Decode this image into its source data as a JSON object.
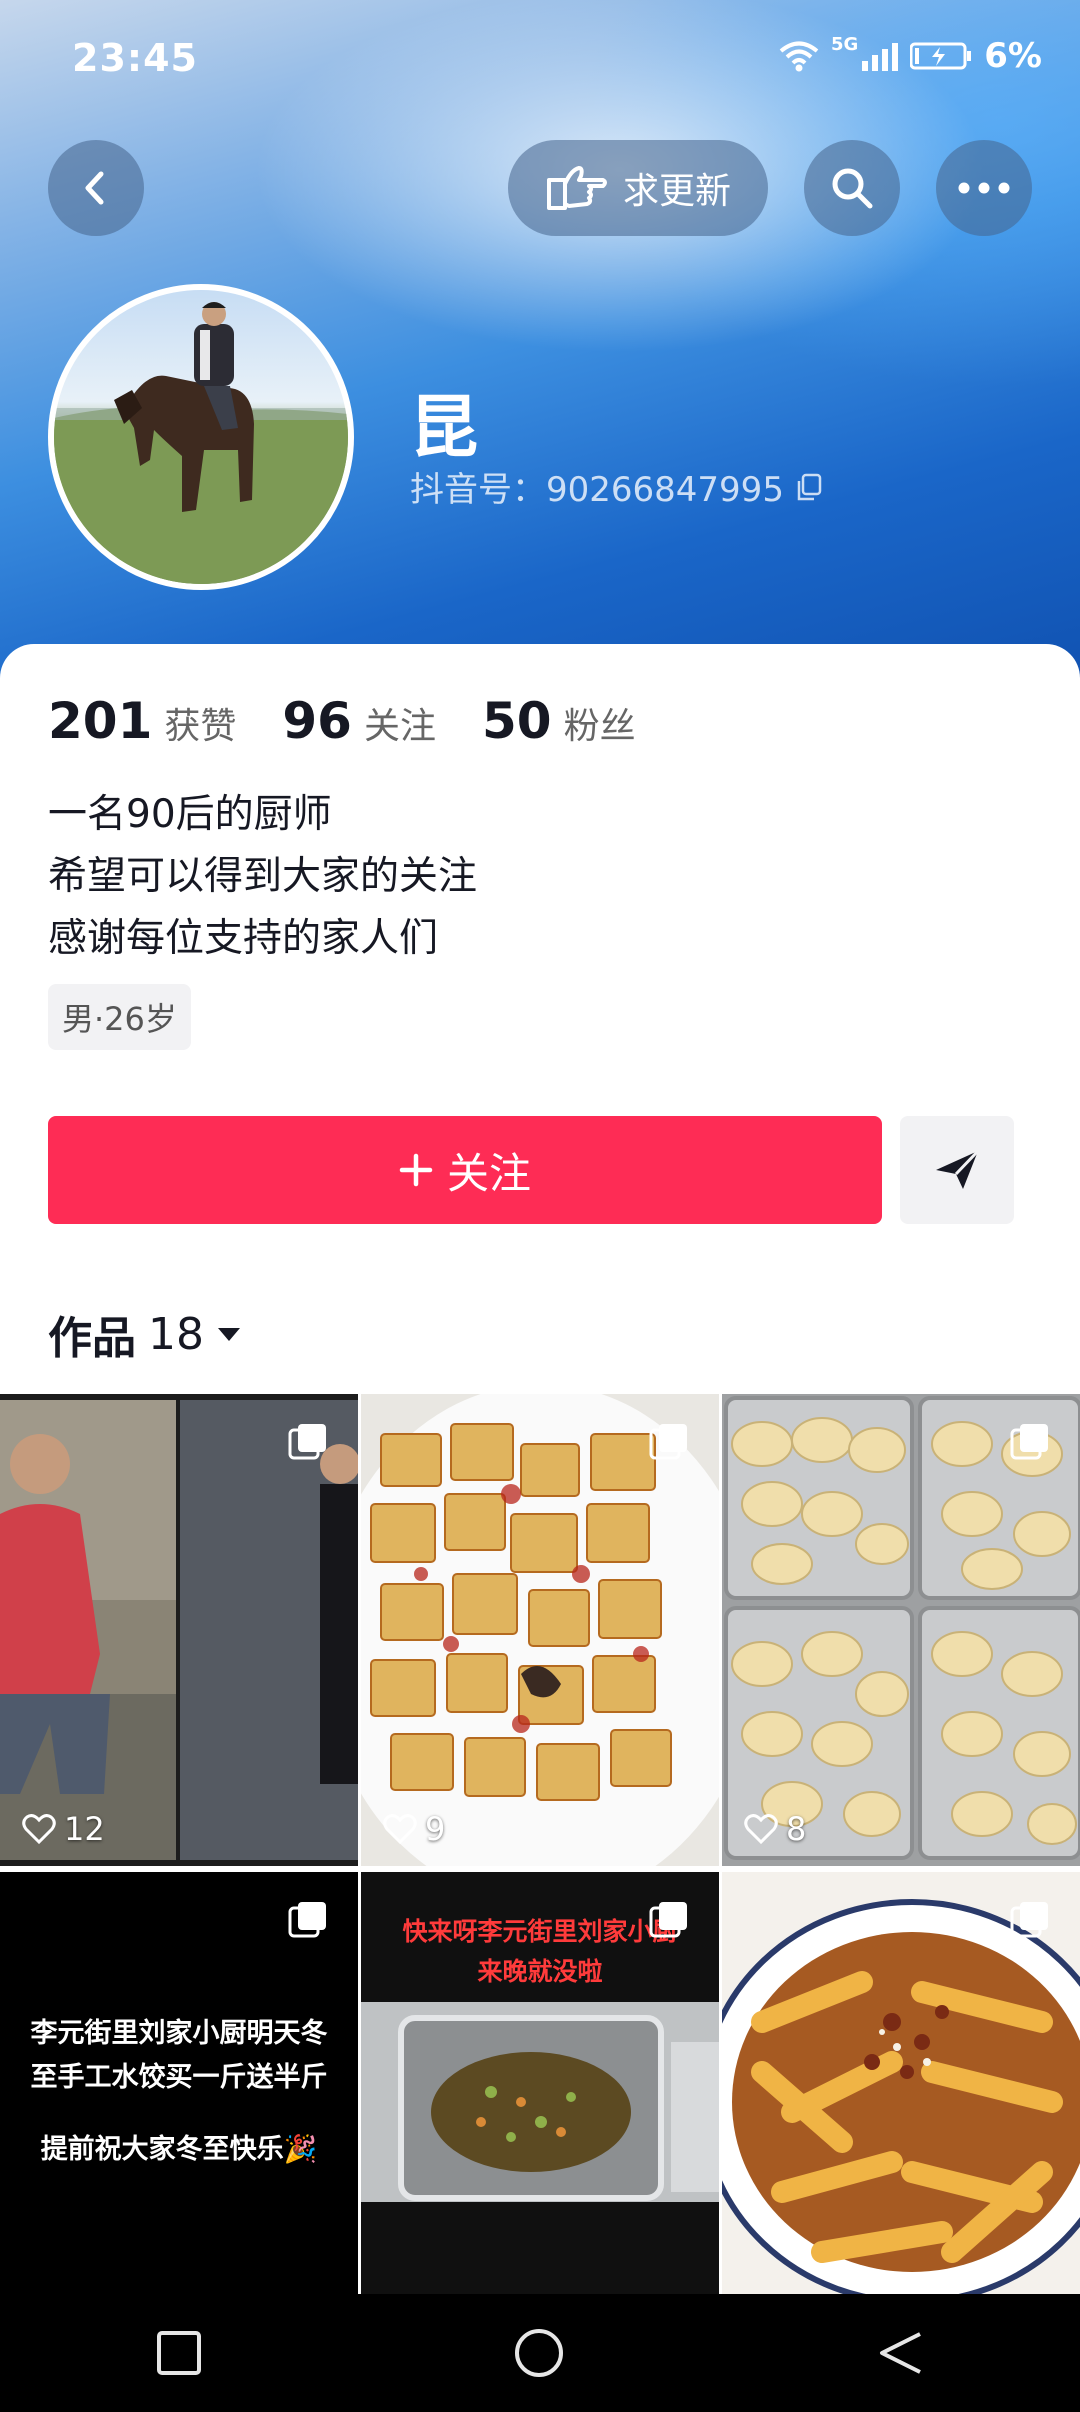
{
  "status_bar": {
    "time": "23:45",
    "network": "5G",
    "battery": "6%"
  },
  "header": {
    "request_update_label": "求更新"
  },
  "profile": {
    "name": "昆",
    "douyin_id": "抖音号：90266847995"
  },
  "stats": [
    {
      "value": "201",
      "label": "获赞"
    },
    {
      "value": "96",
      "label": "关注"
    },
    {
      "value": "50",
      "label": "粉丝"
    }
  ],
  "bio": [
    "一名90后的厨师",
    "希望可以得到大家的关注",
    "感谢每位支持的家人们"
  ],
  "tag": "男·26岁",
  "follow_label": "关注",
  "works": {
    "label": "作品",
    "count": "18"
  },
  "videos": [
    {
      "likes": "12"
    },
    {
      "likes": "9"
    },
    {
      "likes": "8"
    },
    {
      "overlay": [
        "李元街里刘家小厨明天冬",
        "至手工水饺买一斤送半斤",
        "",
        "提前祝大家冬至快乐🎉"
      ]
    },
    {
      "overlay": [
        "快来呀李元街里刘家小厨",
        "来晚就没啦"
      ]
    },
    {}
  ],
  "colors": {
    "accent": "#fe2c55",
    "header_blue": "#1a66c8"
  }
}
